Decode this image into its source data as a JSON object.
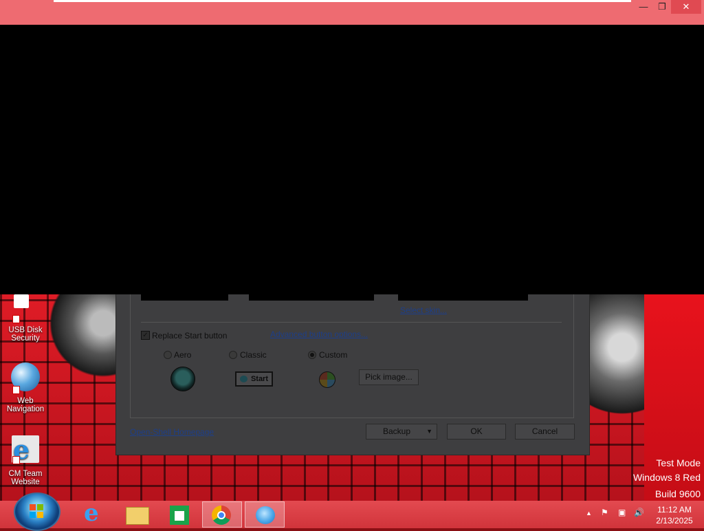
{
  "window": {
    "minimize_label": "—",
    "maximize_label": "❐",
    "close_label": "✕"
  },
  "dialog": {
    "select_skin_link": "Select skin...",
    "replace_start_label": "Replace Start button",
    "replace_start_checked": true,
    "advanced_options_link": "Advanced button options...",
    "styles": [
      {
        "label": "Aero",
        "selected": false
      },
      {
        "label": "Classic",
        "selected": false
      },
      {
        "label": "Custom",
        "selected": true
      }
    ],
    "classic_button_label": "Start",
    "pick_image_label": "Pick image...",
    "homepage_link": "Open-Shell Homepage",
    "backup_label": "Backup",
    "ok_label": "OK",
    "cancel_label": "Cancel"
  },
  "desktop_icons": [
    {
      "label_line1": "USB Disk",
      "label_line2": "Security",
      "icon": "usb-disk-security-icon"
    },
    {
      "label_line1": "Web",
      "label_line2": "Navigation",
      "icon": "web-navigation-icon"
    },
    {
      "label_line1": "CM Team",
      "label_line2": "Website",
      "icon": "internet-explorer-icon"
    }
  ],
  "watermark": {
    "line1": "Test Mode",
    "line2": "Windows 8 Red",
    "line3": "Build 9600"
  },
  "taskbar": {
    "items": [
      {
        "name": "internet-explorer",
        "active": false
      },
      {
        "name": "file-explorer",
        "active": false
      },
      {
        "name": "store",
        "active": false
      },
      {
        "name": "chrome",
        "active": true
      },
      {
        "name": "open-shell",
        "active": true
      }
    ],
    "time": "11:12 AM",
    "date": "2/13/2025"
  }
}
